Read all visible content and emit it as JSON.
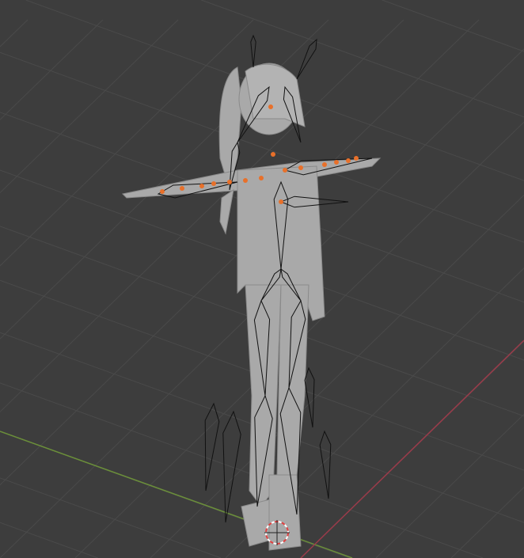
{
  "viewport": {
    "background_color": "#3d3d3d",
    "grid_color": "#4a4a4a",
    "x_axis_color": "#6b8f3a",
    "y_axis_color": "#9a3b4a",
    "mesh_color": "#a8a8a8",
    "bone_color": "#111111",
    "selected_bone_color": "#e8702a"
  },
  "icons": [
    "3d-cursor-icon"
  ]
}
